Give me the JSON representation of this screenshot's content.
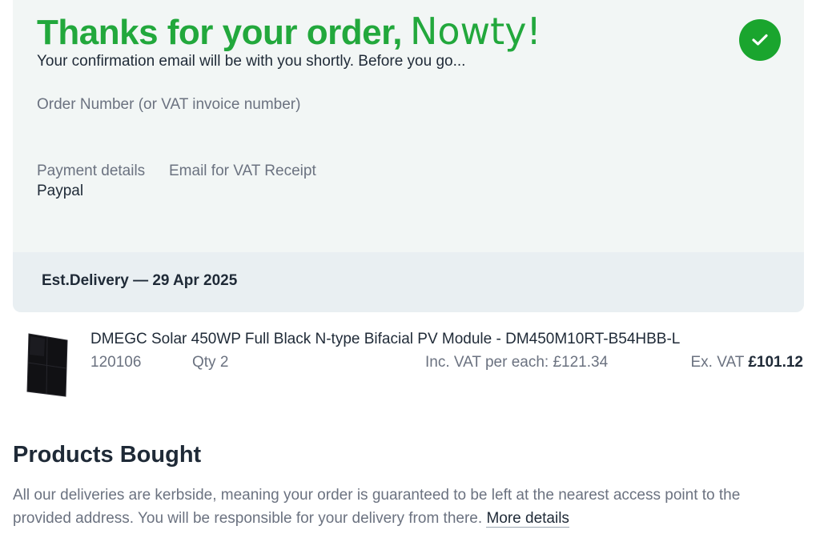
{
  "confirmation": {
    "thanks": "Thanks for your order,",
    "customer_name": "Nowty!",
    "subtext": "Your confirmation email will be with you shortly. Before you go...",
    "order_number_label": "Order Number (or VAT invoice number)",
    "payment_label": "Payment details",
    "payment_value": "Paypal",
    "email_label": "Email for VAT Receipt",
    "status_icon": "check-icon",
    "accent_color": "#22a83c"
  },
  "delivery": {
    "text": "Est.Delivery — 29 Apr 2025"
  },
  "product": {
    "name": "DMEGC Solar 450WP Full Black N-type Bifacial PV Module - DM450M10RT-B54HBB-L",
    "sku": "120106",
    "qty": "Qty 2",
    "inc_vat": "Inc. VAT per each: £121.34",
    "ex_vat_label": "Ex. VAT",
    "ex_vat_price": "£101.12",
    "image": "solar-panel-thumbnail"
  },
  "products_section": {
    "title": "Products Bought",
    "text": "All our deliveries are kerbside, meaning your order is guaranteed to be left at the nearest access point to the provided address. You will be responsible for your delivery from there.",
    "link": "More details"
  }
}
